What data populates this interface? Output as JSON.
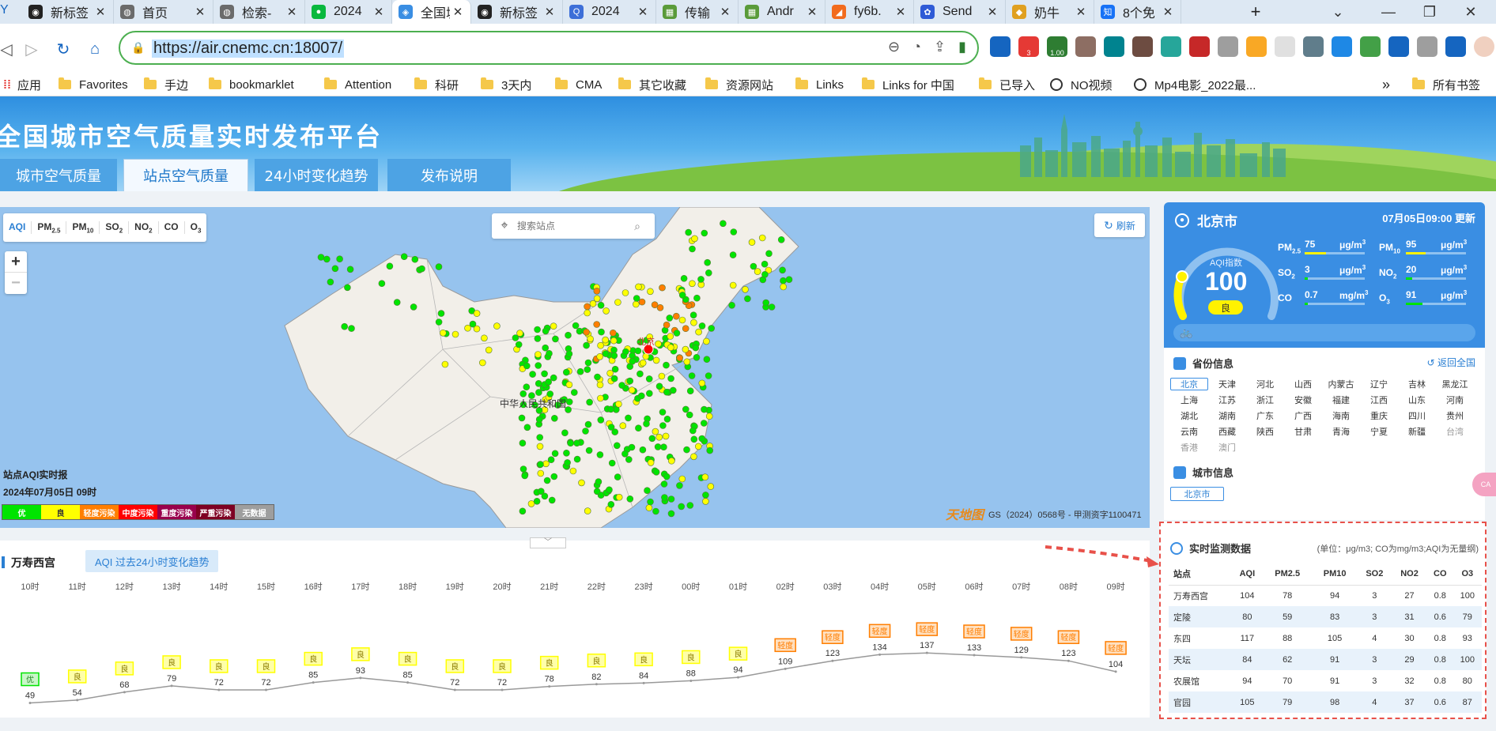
{
  "browser": {
    "tabs": [
      {
        "title": "新标签",
        "color": "#222222",
        "glyph": "◉",
        "active": false
      },
      {
        "title": "首页",
        "color": "#6b6b6b",
        "glyph": "◍",
        "active": false
      },
      {
        "title": "检索-",
        "color": "#6b6b6b",
        "glyph": "◍",
        "active": false
      },
      {
        "title": "2024",
        "color": "#09b83e",
        "glyph": "●",
        "active": false
      },
      {
        "title": "全国城",
        "color": "#3a8ee3",
        "glyph": "◈",
        "active": true
      },
      {
        "title": "新标签",
        "color": "#222222",
        "glyph": "◉",
        "active": false
      },
      {
        "title": "2024",
        "color": "#3d6fd8",
        "glyph": "Q",
        "active": false
      },
      {
        "title": "传输",
        "color": "#5a9b3a",
        "glyph": "▦",
        "active": false
      },
      {
        "title": "Andr",
        "color": "#5a9b3a",
        "glyph": "▦",
        "active": false
      },
      {
        "title": "fy6b.",
        "color": "#f26b1d",
        "glyph": "◢",
        "active": false
      },
      {
        "title": "Send",
        "color": "#2f5bd6",
        "glyph": "✿",
        "active": false
      },
      {
        "title": "奶牛",
        "color": "#e0a020",
        "glyph": "◆",
        "active": false
      },
      {
        "title": "8个免",
        "color": "#1772f6",
        "glyph": "知",
        "active": false
      }
    ],
    "new_tab": "+",
    "url": "https://air.cnemc.cn:18007/",
    "extensions": [
      "#1565c0",
      "#e53935",
      "#2e7d32",
      "#8d6e63",
      "#00838f",
      "#6d4c41",
      "#26a69a",
      "#c62828",
      "#9e9e9e",
      "#f9a825",
      "#e0e0e0",
      "#607d8b",
      "#1e88e5",
      "#43a047",
      "#1565c0",
      "#9e9e9e",
      "#1565c0"
    ],
    "ext_badges": {
      "1": "3",
      "2": "1.00"
    },
    "bookmarks": [
      {
        "label": "应用",
        "kind": "apps"
      },
      {
        "label": "Favorites",
        "kind": "folder"
      },
      {
        "label": "手边",
        "kind": "folder"
      },
      {
        "label": "bookmarklet",
        "kind": "folder"
      },
      {
        "label": "Attention",
        "kind": "folder"
      },
      {
        "label": "科研",
        "kind": "folder"
      },
      {
        "label": "3天内",
        "kind": "folder"
      },
      {
        "label": "CMA",
        "kind": "folder"
      },
      {
        "label": "其它收藏",
        "kind": "folder"
      },
      {
        "label": "资源网站",
        "kind": "folder"
      },
      {
        "label": "Links",
        "kind": "folder"
      },
      {
        "label": "Links for 中国",
        "kind": "folder"
      },
      {
        "label": "已导入",
        "kind": "folder"
      },
      {
        "label": "NO视频",
        "kind": "globe"
      },
      {
        "label": "Mp4电影_2022最...",
        "kind": "globe"
      }
    ],
    "more": "»",
    "all_bookmarks": "所有书签"
  },
  "site": {
    "title": "全国城市空气质量实时发布平台",
    "nav": [
      {
        "label": "城市空气质量",
        "active": false
      },
      {
        "label": "站点空气质量",
        "active": true
      },
      {
        "label": "24小时变化趋势",
        "active": false
      },
      {
        "label": "发布说明",
        "active": false
      }
    ]
  },
  "map": {
    "pollutant_tabs": [
      {
        "label": "AQI",
        "sub": "",
        "active": true
      },
      {
        "label": "PM",
        "sub": "2.5",
        "active": false
      },
      {
        "label": "PM",
        "sub": "10",
        "active": false
      },
      {
        "label": "SO",
        "sub": "2",
        "active": false
      },
      {
        "label": "NO",
        "sub": "2",
        "active": false
      },
      {
        "label": "CO",
        "sub": "",
        "active": false
      },
      {
        "label": "O",
        "sub": "3",
        "active": false
      }
    ],
    "search_placeholder": "搜索站点",
    "refresh_label": "刷新",
    "zoom_in": "+",
    "zoom_out": "−",
    "country_label": "中华人民共和国",
    "capital_label": "北京",
    "legend_title": "站点AQI实时报",
    "legend_time": "2024年07月05日 09时",
    "legend": [
      {
        "label": "优",
        "color": "#00e400",
        "text": "#ffffff"
      },
      {
        "label": "良",
        "color": "#ffff00",
        "text": "#333333"
      },
      {
        "label": "轻度污染",
        "color": "#ff7e00",
        "text": "#ffffff"
      },
      {
        "label": "中度污染",
        "color": "#ff0000",
        "text": "#ffffff"
      },
      {
        "label": "重度污染",
        "color": "#99004c",
        "text": "#ffffff"
      },
      {
        "label": "严重污染",
        "color": "#7e0023",
        "text": "#ffffff"
      },
      {
        "label": "无数据",
        "color": "#9e9e9e",
        "text": "#ffffff"
      }
    ],
    "tianditu": "天地图",
    "copyright": "GS（2024）0568号 - 甲测资字1100471"
  },
  "trend": {
    "station": "万寿西宫",
    "button": "AQI 过去24小时变化趋势",
    "collapse": "﹀",
    "chart_data": {
      "type": "line",
      "categories": [
        "10时",
        "11时",
        "12时",
        "13时",
        "14时",
        "15时",
        "16时",
        "17时",
        "18时",
        "19时",
        "20时",
        "21时",
        "22时",
        "23时",
        "00时",
        "01时",
        "02时",
        "03时",
        "04时",
        "05时",
        "06时",
        "07时",
        "08时",
        "09时"
      ],
      "values": [
        49,
        54,
        68,
        79,
        72,
        72,
        85,
        93,
        85,
        72,
        72,
        78,
        82,
        84,
        88,
        94,
        109,
        123,
        134,
        137,
        133,
        129,
        123,
        104
      ],
      "levels": [
        "优",
        "良",
        "良",
        "良",
        "良",
        "良",
        "良",
        "良",
        "良",
        "良",
        "良",
        "良",
        "良",
        "良",
        "良",
        "良",
        "轻度",
        "轻度",
        "轻度",
        "轻度",
        "轻度",
        "轻度",
        "轻度",
        "轻度"
      ],
      "level_colors": {
        "优": "#00e400",
        "良": "#ffff00",
        "轻度": "#ff7e00"
      },
      "line_color": "#999999"
    }
  },
  "city": {
    "name": "北京市",
    "time": "07月05日09:00 更新",
    "aqi_label": "AQI指数",
    "aqi": "100",
    "level": "良",
    "bike": "🚲",
    "pollutants": [
      {
        "name": "PM",
        "sub": "2.5",
        "value": "75",
        "unit": "μg/m",
        "sup": "3",
        "fill": 0.36,
        "color": "#fff200"
      },
      {
        "name": "PM",
        "sub": "10",
        "value": "95",
        "unit": "μg/m",
        "sup": "3",
        "fill": 0.33,
        "color": "#fff200"
      },
      {
        "name": "SO",
        "sub": "2",
        "value": "3",
        "unit": "μg/m",
        "sup": "3",
        "fill": 0.02,
        "color": "#00e400"
      },
      {
        "name": "NO",
        "sub": "2",
        "value": "20",
        "unit": "μg/m",
        "sup": "3",
        "fill": 0.1,
        "color": "#00e400"
      },
      {
        "name": "CO",
        "sub": "",
        "value": "0.7",
        "unit": "mg/m",
        "sup": "3",
        "fill": 0.04,
        "color": "#00e400"
      },
      {
        "name": "O",
        "sub": "3",
        "value": "91",
        "unit": "μg/m",
        "sup": "3",
        "fill": 0.28,
        "color": "#00e400"
      }
    ]
  },
  "province": {
    "title": "省份信息",
    "back": "返回全国",
    "items": [
      "北京",
      "天津",
      "河北",
      "山西",
      "内蒙古",
      "辽宁",
      "吉林",
      "黑龙江",
      "上海",
      "江苏",
      "浙江",
      "安徽",
      "福建",
      "江西",
      "山东",
      "河南",
      "湖北",
      "湖南",
      "广东",
      "广西",
      "海南",
      "重庆",
      "四川",
      "贵州",
      "云南",
      "西藏",
      "陕西",
      "甘肃",
      "青海",
      "宁夏",
      "新疆",
      "台湾",
      "香港",
      "澳门"
    ],
    "active": "北京",
    "grey": [
      "台湾",
      "香港",
      "澳门"
    ],
    "city_title": "城市信息",
    "city_chip": "北京市"
  },
  "realtime": {
    "title": "实时监测数据",
    "unit_note": "(单位：μg/m3; CO为mg/m3;AQI为无量纲)",
    "headers": [
      "站点",
      "AQI",
      "PM2.5",
      "PM10",
      "SO2",
      "NO2",
      "CO",
      "O3"
    ],
    "rows": [
      [
        "万寿西宫",
        "104",
        "78",
        "94",
        "3",
        "27",
        "0.8",
        "100"
      ],
      [
        "定陵",
        "80",
        "59",
        "83",
        "3",
        "31",
        "0.6",
        "79"
      ],
      [
        "东四",
        "117",
        "88",
        "105",
        "4",
        "30",
        "0.8",
        "93"
      ],
      [
        "天坛",
        "84",
        "62",
        "91",
        "3",
        "29",
        "0.8",
        "100"
      ],
      [
        "农展馆",
        "94",
        "70",
        "91",
        "3",
        "32",
        "0.8",
        "80"
      ],
      [
        "官园",
        "105",
        "79",
        "98",
        "4",
        "37",
        "0.6",
        "87"
      ]
    ]
  }
}
